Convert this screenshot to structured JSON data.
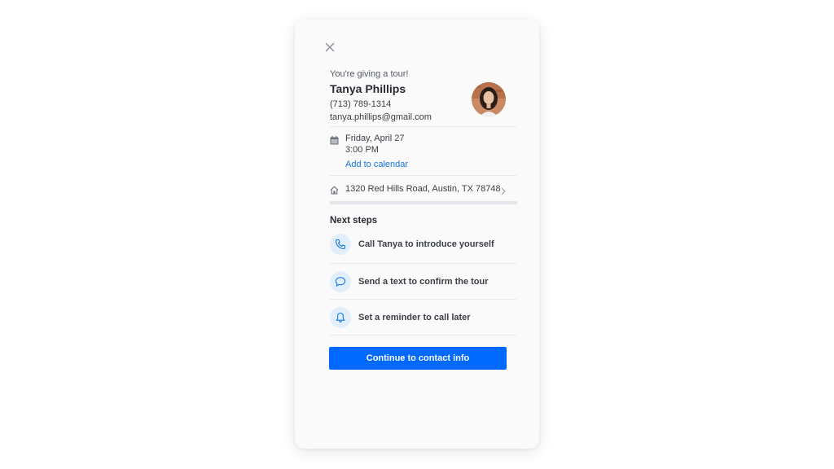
{
  "modal": {
    "close_icon": "close-icon"
  },
  "agent": {
    "eyebrow": "You're giving a tour!",
    "name": "Tanya Phillips",
    "phone": "(713) 789-1314",
    "email": "tanya.phillips@gmail.com",
    "avatar_icon": "avatar-photo"
  },
  "tour": {
    "date": "Friday, April 27",
    "time": "3:00 PM",
    "add_to_calendar": "Add to calendar",
    "calendar_icon": "calendar-icon"
  },
  "property": {
    "address": "1320 Red Hills Road, Austin, TX 78748",
    "home_icon": "home-icon",
    "chevron_icon": "chevron-right-icon"
  },
  "next_steps": {
    "title": "Next steps",
    "items": [
      {
        "label": "Call Tanya to introduce yourself",
        "icon": "phone-icon"
      },
      {
        "label": "Send a text to confirm the tour",
        "icon": "chat-bubble-icon"
      },
      {
        "label": "Set a reminder to call later",
        "icon": "bell-icon"
      }
    ]
  },
  "cta": {
    "label": "Continue to contact info"
  },
  "colors": {
    "accent": "#006aff",
    "link": "#1277e1",
    "icon_bg": "#e3eefc",
    "icon_stroke": "#1277e1"
  }
}
